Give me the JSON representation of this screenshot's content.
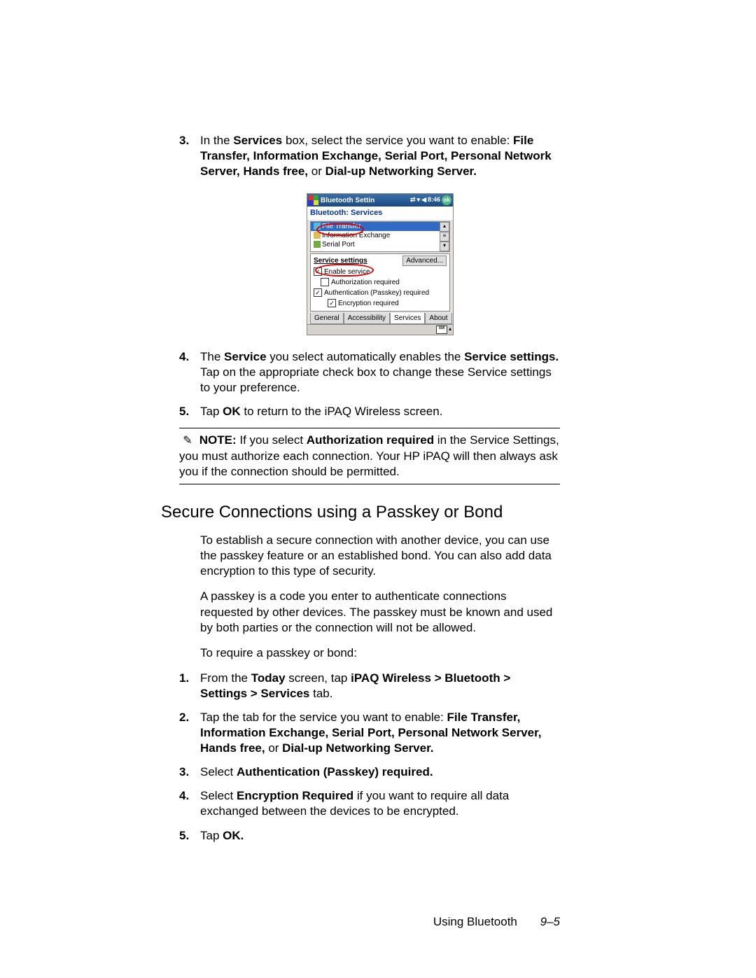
{
  "steps_top": {
    "item3": {
      "num": "3.",
      "t1": "In the ",
      "b1": "Services",
      "t2": " box, select the service you want to enable: ",
      "b2": "File Transfer, Information Exchange, Serial Port, Personal Network Server, Hands free,",
      "t3": " or ",
      "b3": "Dial-up Networking Server."
    },
    "item4": {
      "num": "4.",
      "t1": "The ",
      "b1": "Service",
      "t2": " you select automatically enables the ",
      "b2": "Service settings.",
      "t3": " Tap on the appropriate check box to change these Service settings to your preference."
    },
    "item5": {
      "num": "5.",
      "t1": "Tap ",
      "b1": "OK",
      "t2": " to return to the iPAQ Wireless screen."
    }
  },
  "note": {
    "label": "NOTE:",
    "t1": "  If you select ",
    "b1": "Authorization required",
    "t2": " in the Service Settings, you must authorize each connection. Your HP iPAQ will then always ask you if the connection should be permitted."
  },
  "subsection_title": "Secure Connections using a Passkey or Bond",
  "para1": "To establish a secure connection with another device, you can use the passkey feature or an established bond. You can also add data encryption to this type of security.",
  "para2": "A passkey is a code you enter to authenticate connections requested by other devices. The passkey must be known and used by both parties or the connection will not be allowed.",
  "para3": "To require a passkey or bond:",
  "steps_bottom": {
    "item1": {
      "num": "1.",
      "t1": "From the ",
      "b1": "Today",
      "t2": " screen, tap ",
      "b2": "iPAQ Wireless > Bluetooth > Settings > Services",
      "t3": " tab."
    },
    "item2": {
      "num": "2.",
      "t1": "Tap the tab for the service you want to enable: ",
      "b1": "File Transfer, Information Exchange, Serial Port, Personal Network Server, Hands free,",
      "t2": " or ",
      "b2": "Dial-up Networking Server."
    },
    "item3": {
      "num": "3.",
      "t1": "Select ",
      "b1": "Authentication (Passkey) required."
    },
    "item4": {
      "num": "4.",
      "t1": "Select ",
      "b1": "Encryption Required",
      "t2": " if you want to require all data exchanged between the devices to be encrypted."
    },
    "item5": {
      "num": "5.",
      "t1": "Tap ",
      "b1": "OK."
    }
  },
  "screenshot": {
    "title": "Bluetooth Settin",
    "time": "8:46",
    "ok": "ok",
    "subhead": "Bluetooth: Services",
    "list": [
      "File Transfer",
      "Information Exchange",
      "Serial Port"
    ],
    "svc_settings_label": "Service settings",
    "advanced": "Advanced...",
    "checks": {
      "enable": "Enable service",
      "auth_req": "Authorization required",
      "passkey": "Authentication (Passkey) required",
      "encrypt": "Encryption required"
    },
    "tabs": [
      "General",
      "Accessibility",
      "Services",
      "About"
    ]
  },
  "footer": {
    "chapter": "Using Bluetooth",
    "page": "9–5"
  }
}
